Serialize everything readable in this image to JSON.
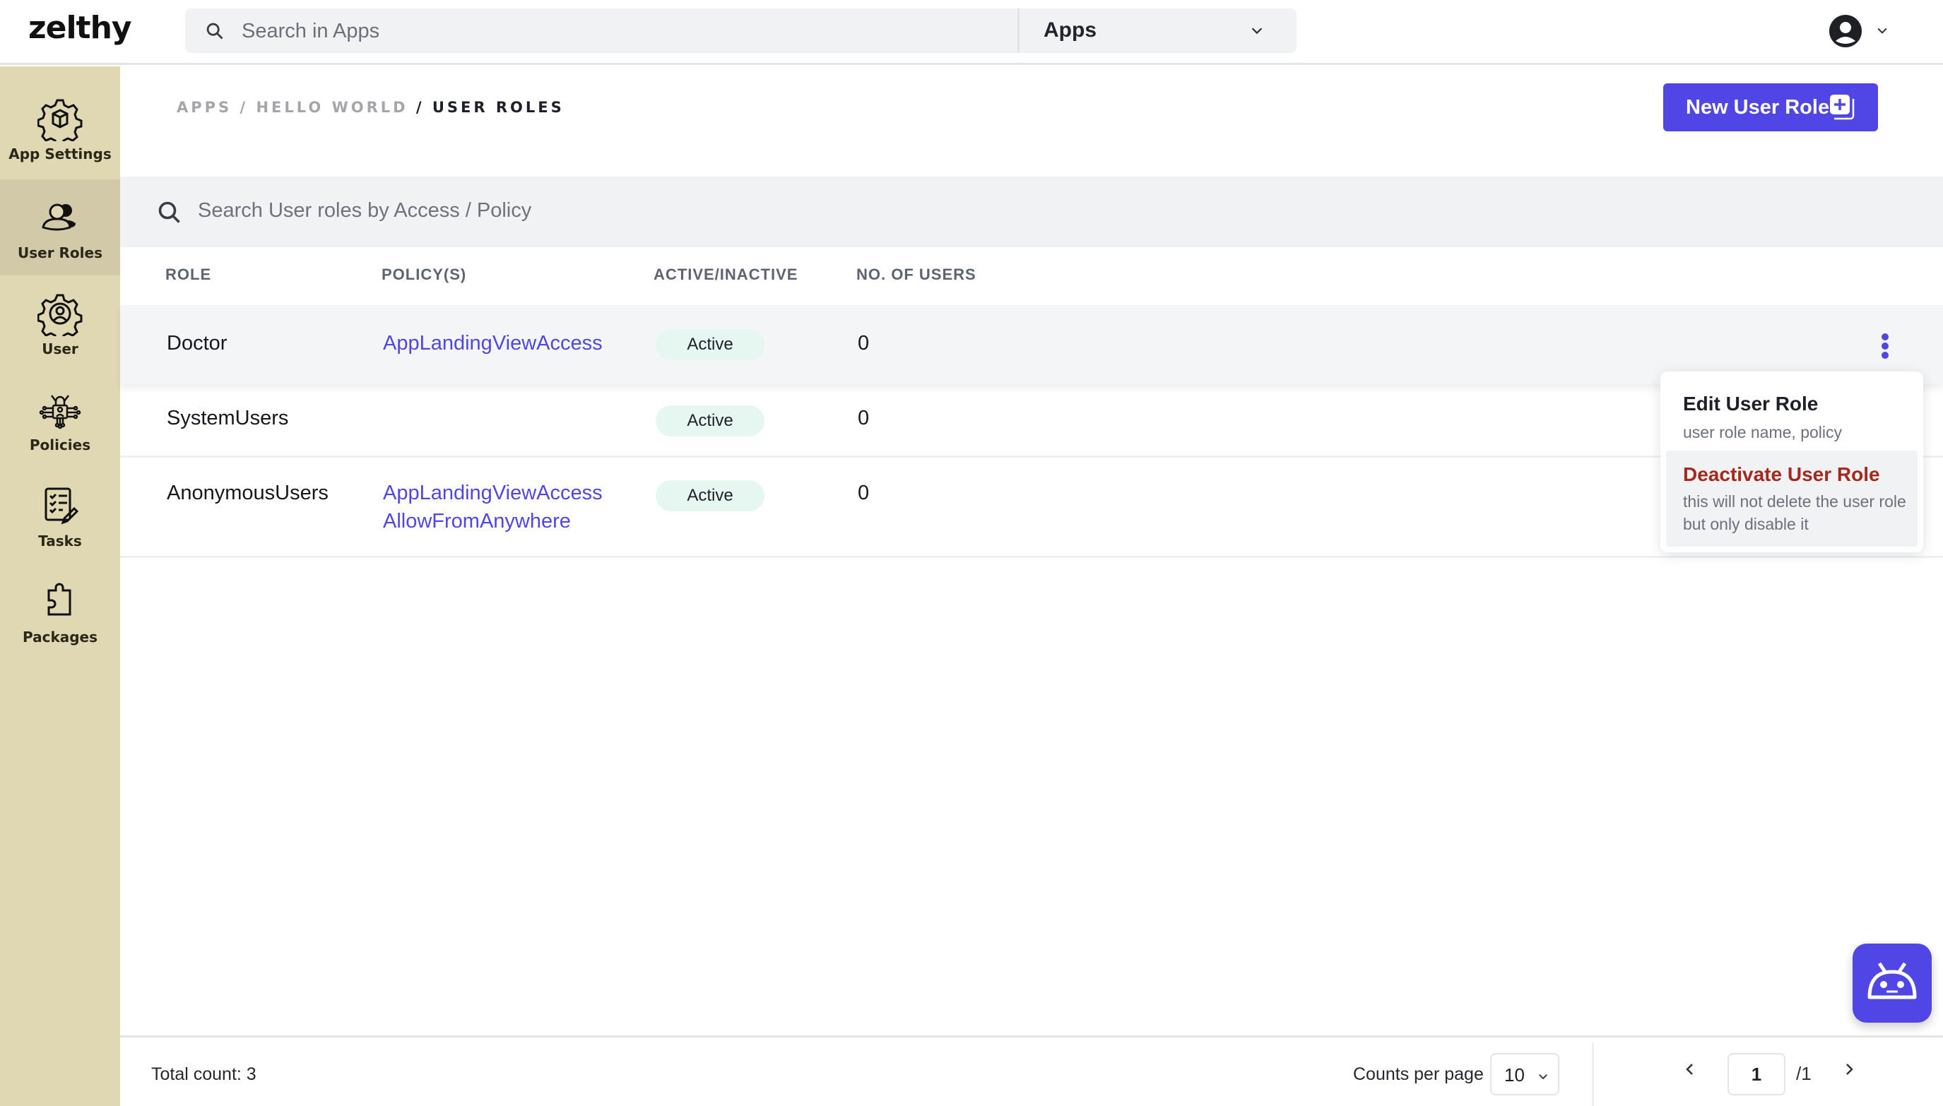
{
  "header": {
    "logo": "zelthy",
    "search_placeholder": "Search in Apps",
    "apps_select": "Apps",
    "icons": {
      "search": "search-icon",
      "chevron": "chevron-down-icon",
      "avatar": "user-avatar-icon"
    }
  },
  "sidebar": {
    "items": [
      {
        "label": "App Settings",
        "icon": "gear-cube-icon",
        "active": false
      },
      {
        "label": "User Roles",
        "icon": "users-icon",
        "active": true
      },
      {
        "label": "User",
        "icon": "gear-user-icon",
        "active": false
      },
      {
        "label": "Policies",
        "icon": "lock-circuit-icon",
        "active": false
      },
      {
        "label": "Tasks",
        "icon": "checklist-pencil-icon",
        "active": false
      },
      {
        "label": "Packages",
        "icon": "puzzle-icon",
        "active": false
      }
    ]
  },
  "breadcrumb": {
    "items": [
      "APPS",
      "HELLO WORLD",
      "USER ROLES"
    ],
    "separator": "/"
  },
  "toolbar": {
    "new_role_label": "New User Role",
    "search_placeholder": "Search User roles by Access / Policy"
  },
  "table": {
    "columns": [
      "ROLE",
      "POLICY(S)",
      "ACTIVE/INACTIVE",
      "NO. OF USERS"
    ],
    "rows": [
      {
        "role": "Doctor",
        "policies": [
          "AppLandingViewAccess"
        ],
        "status": "Active",
        "users": "0"
      },
      {
        "role": "SystemUsers",
        "policies": [],
        "status": "Active",
        "users": "0"
      },
      {
        "role": "AnonymousUsers",
        "policies": [
          "AppLandingViewAccess",
          "AllowFromAnywhere"
        ],
        "status": "Active",
        "users": "0"
      }
    ]
  },
  "context_menu": {
    "items": [
      {
        "title": "Edit User Role",
        "description": "user role name, policy"
      },
      {
        "title": "Deactivate User Role",
        "description": "this will not delete the user role but only disable it"
      }
    ]
  },
  "footer": {
    "total_count": "Total count: 3",
    "counts_per_page_label": "Counts per page",
    "counts_per_page_value": "10",
    "current_page": "1",
    "total_pages": "/1"
  },
  "colors": {
    "accent": "#4f46e5",
    "sidebar_bg": "#e0d8b3",
    "sidebar_active": "#d1c9a8",
    "badge_bg": "#e6f6f0",
    "danger": "#a3281d"
  }
}
